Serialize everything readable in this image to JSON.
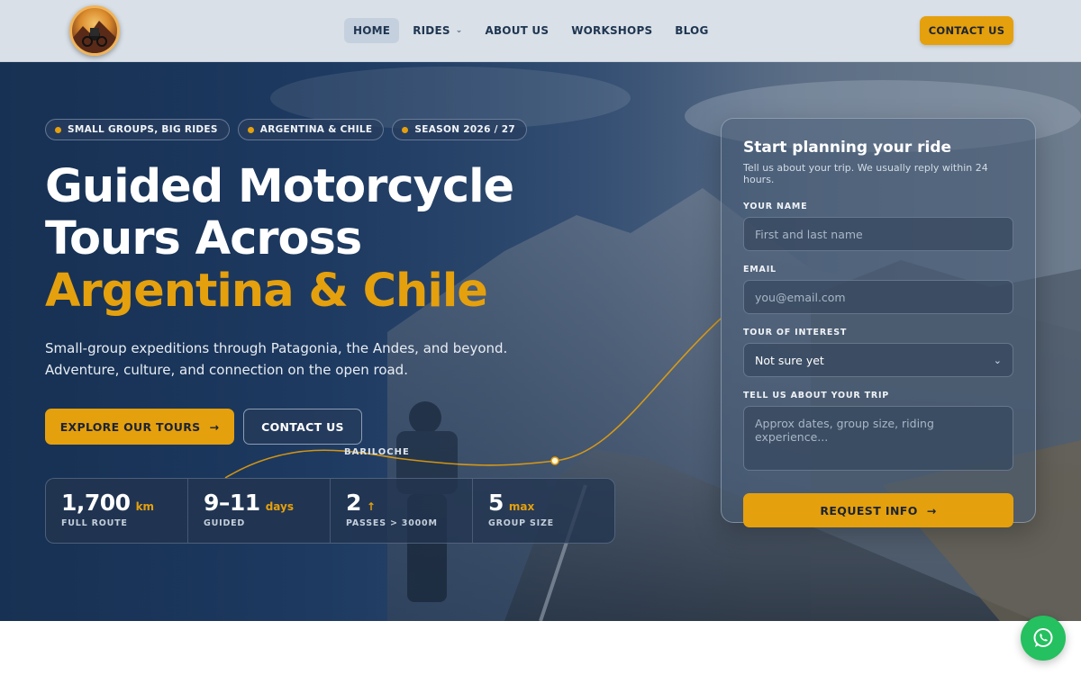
{
  "nav": {
    "logo_name": "motorcycle-logo",
    "links": [
      {
        "label": "HOME",
        "active": true
      },
      {
        "label": "RIDES",
        "has_dropdown": true
      },
      {
        "label": "ABOUT US"
      },
      {
        "label": "WORKSHOPS"
      },
      {
        "label": "BLOG"
      }
    ],
    "cta": "CONTACT US"
  },
  "hero": {
    "chips": [
      "SMALL GROUPS, BIG RIDES",
      "ARGENTINA & CHILE",
      "SEASON 2026 / 27"
    ],
    "headline_line1": "Guided Motorcycle",
    "headline_line2": "Tours Across",
    "headline_accent": "Argentina & Chile",
    "subtitle_line1": "Small-group expeditions through Patagonia, the Andes, and beyond.",
    "subtitle_line2": "Adventure, culture, and connection on the open road.",
    "primary_button": "EXPLORE OUR TOURS",
    "secondary_button": "CONTACT US",
    "route_label": "BARILOCHE",
    "stats": [
      {
        "value": "1,700",
        "unit": "km",
        "label": "FULL ROUTE"
      },
      {
        "value": "9–11",
        "unit": "days",
        "label": "GUIDED"
      },
      {
        "value": "2",
        "unit": "↑",
        "label": "PASSES > 3000M"
      },
      {
        "value": "5",
        "unit": "max",
        "label": "GROUP SIZE"
      }
    ]
  },
  "form": {
    "title": "Start planning your ride",
    "subtitle": "Tell us about your trip. We usually reply within 24 hours.",
    "name_label": "YOUR NAME",
    "name_placeholder": "First and last name",
    "email_label": "EMAIL",
    "email_placeholder": "you@email.com",
    "tour_label": "TOUR OF INTEREST",
    "tour_selected": "Not sure yet",
    "trip_label": "TELL US ABOUT YOUR TRIP",
    "trip_placeholder": "Approx dates, group size, riding experience...",
    "submit": "REQUEST INFO"
  },
  "colors": {
    "accent": "#e5a00d",
    "nav_bg": "#d9e0e8",
    "hero_blue": "#1b3658",
    "whatsapp": "#25c05f"
  },
  "icons": {
    "arrow": "arrow-right-icon",
    "chevron": "chevron-down-icon",
    "whatsapp": "whatsapp-icon"
  }
}
